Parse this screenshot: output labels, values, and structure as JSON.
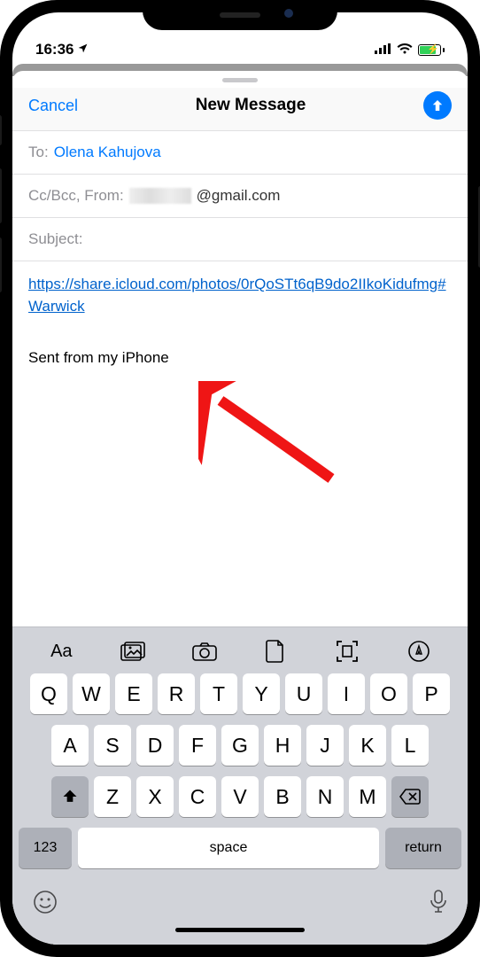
{
  "statusbar": {
    "time": "16:36",
    "location_arrow": "➤"
  },
  "header": {
    "cancel": "Cancel",
    "title": "New Message"
  },
  "compose": {
    "to_label": "To:",
    "to_value": "Olena Kahujova",
    "ccbcc_from_label": "Cc/Bcc, From:",
    "from_suffix": "@gmail.com",
    "subject_label": "Subject:",
    "body_link": "https://share.icloud.com/photos/0rQoSTt6qB9do2IIkoKidufmg#Warwick",
    "signature": "Sent from my iPhone"
  },
  "keyboard": {
    "toolbar": [
      "Aa",
      "photos",
      "camera",
      "document",
      "scan",
      "markup"
    ],
    "row1": [
      "Q",
      "W",
      "E",
      "R",
      "T",
      "Y",
      "U",
      "I",
      "O",
      "P"
    ],
    "row2": [
      "A",
      "S",
      "D",
      "F",
      "G",
      "H",
      "J",
      "K",
      "L"
    ],
    "row3": [
      "Z",
      "X",
      "C",
      "V",
      "B",
      "N",
      "M"
    ],
    "numkey": "123",
    "space": "space",
    "return": "return"
  }
}
